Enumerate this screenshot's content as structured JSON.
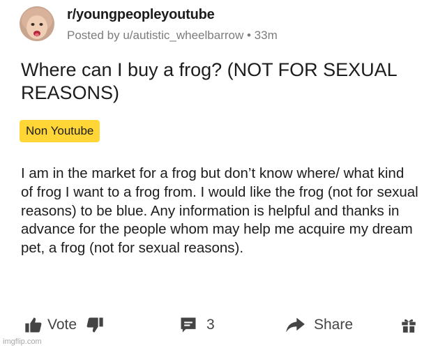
{
  "post": {
    "subreddit": "r/youngpeopleyoutube",
    "posted_by": "Posted by u/autistic_wheelbarrow",
    "separator": "•",
    "age": "33m",
    "title": "Where can I buy a frog? (NOT FOR SEXUAL REASONS)",
    "flair": "Non Youtube",
    "body": "I am in the market for a frog but don’t know where/ what kind of frog I want to a frog from. I would like the frog (not for sexual reasons) to be blue. Any information is helpful and thanks in advance for the people whom may help me acquire my dream pet, a frog (not for sexual reasons)."
  },
  "actions": {
    "vote_label": "Vote",
    "comment_count": "3",
    "share_label": "Share"
  },
  "icons": {
    "upvote": "thumbs-up-icon",
    "downvote": "thumbs-down-icon",
    "comment": "comment-icon",
    "share": "share-arrow-icon",
    "award": "gift-icon"
  },
  "watermark": "imgflip.com",
  "colors": {
    "flair_background": "#ffd635",
    "meta_text": "#7c7c7c",
    "text": "#1c1c1c"
  }
}
